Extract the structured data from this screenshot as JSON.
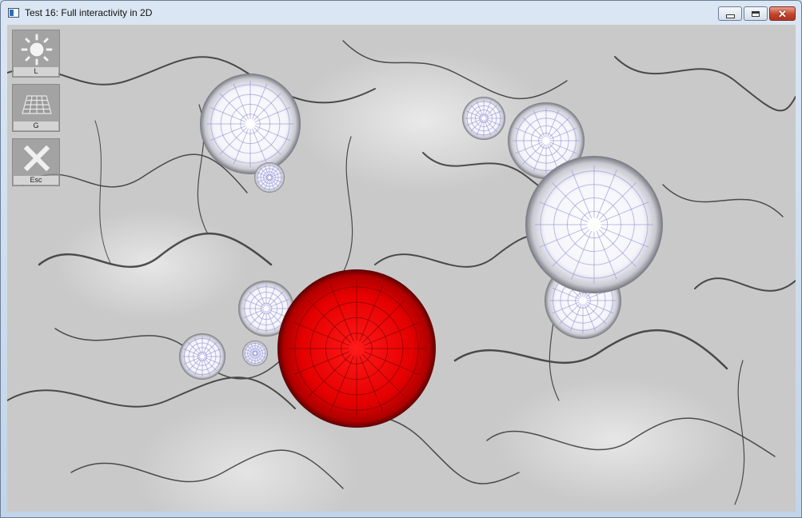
{
  "window": {
    "title": "Test 16: Full interactivity in 2D",
    "minimize_glyph": "minimize-icon",
    "maximize_glyph": "maximize-icon",
    "close_glyph": "✕"
  },
  "toolbar": {
    "light_key": "L",
    "grid_key": "G",
    "exit_key": "Esc"
  },
  "colors": {
    "marble": "#c9c9c9",
    "sphere": "#f2f2f6",
    "sphere_grid": "#8f8fd6",
    "active_sphere": "#e20000",
    "active_grid": "#6a0000"
  }
}
